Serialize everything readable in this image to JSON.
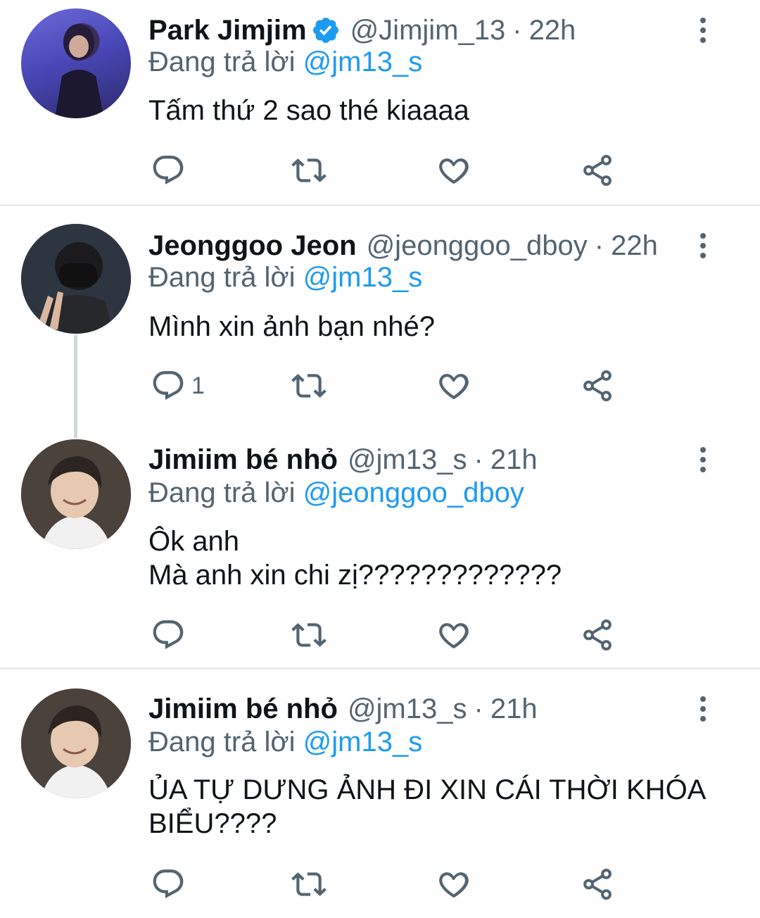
{
  "tweets": [
    {
      "name": "Park Jimjim",
      "verified": true,
      "handle": "@Jimjim_13",
      "time": "22h",
      "reply_prefix": "Đang trả lời",
      "reply_to": "@jm13_s",
      "lines": [
        "Tấm thứ 2 sao thé kiaaaa"
      ],
      "reply_count": ""
    },
    {
      "name": "Jeonggoo Jeon",
      "verified": false,
      "handle": "@jeonggoo_dboy",
      "time": "22h",
      "reply_prefix": "Đang trả lời",
      "reply_to": "@jm13_s",
      "lines": [
        "Mình xin ảnh bạn nhé?"
      ],
      "reply_count": "1"
    },
    {
      "name": "Jimiim bé nhỏ",
      "verified": false,
      "handle": "@jm13_s",
      "time": "21h",
      "reply_prefix": "Đang trả lời",
      "reply_to": "@jeonggoo_dboy",
      "lines": [
        "Ôk anh",
        "Mà anh xin chi zị?????????????"
      ],
      "reply_count": ""
    },
    {
      "name": "Jimiim bé nhỏ",
      "verified": false,
      "handle": "@jm13_s",
      "time": "21h",
      "reply_prefix": "Đang trả lời",
      "reply_to": "@jm13_s",
      "lines": [
        "ỦA TỰ DƯNG ẢNH ĐI XIN CÁI THỜI KHÓA",
        "BIỂU????"
      ],
      "reply_count": ""
    }
  ],
  "separator": "·",
  "colors": {
    "accent": "#1d9bf0",
    "muted": "#536471",
    "text": "#0f1419",
    "icon": "#536471"
  },
  "icons": [
    "reply-icon",
    "retweet-icon",
    "like-icon",
    "share-icon",
    "more-icon",
    "verified-badge-icon"
  ]
}
